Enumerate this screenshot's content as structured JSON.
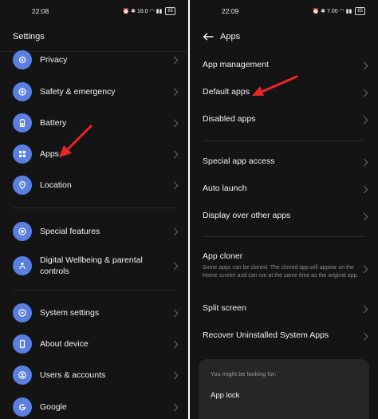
{
  "left": {
    "status_time": "22:08",
    "status_icons": "⏰ ✱ 18.0 ◠ ▮▮",
    "battery": "65",
    "title": "Settings",
    "items": [
      {
        "label": "Privacy",
        "icon": "privacy-icon"
      },
      {
        "label": "Safety & emergency",
        "icon": "safety-icon"
      },
      {
        "label": "Battery",
        "icon": "battery-icon"
      },
      {
        "label": "Apps",
        "icon": "apps-icon"
      },
      {
        "label": "Location",
        "icon": "location-icon"
      },
      {
        "label": "Special features",
        "icon": "special-features-icon"
      },
      {
        "label": "Digital Wellbeing & parental controls",
        "icon": "wellbeing-icon"
      },
      {
        "label": "System settings",
        "icon": "system-settings-icon"
      },
      {
        "label": "About device",
        "icon": "about-device-icon"
      },
      {
        "label": "Users & accounts",
        "icon": "users-icon"
      },
      {
        "label": "Google",
        "icon": "google-icon"
      }
    ]
  },
  "right": {
    "status_time": "22:09",
    "status_icons": "⏰ ✱ 7.00 ◠ ▮▮",
    "battery": "65",
    "title": "Apps",
    "items": [
      {
        "label": "App management"
      },
      {
        "label": "Default apps"
      },
      {
        "label": "Disabled apps"
      },
      {
        "label": "Special app access"
      },
      {
        "label": "Auto launch"
      },
      {
        "label": "Display over other apps"
      },
      {
        "label": "App cloner",
        "desc": "Some apps can be cloned. The cloned app will appear on the Home screen and can run at the same time as the original app."
      },
      {
        "label": "Split screen"
      },
      {
        "label": "Recover Uninstalled System Apps"
      }
    ],
    "suggest_title": "You might be looking for:",
    "suggest_item": "App lock"
  },
  "colors": {
    "accent_icon": "#5b7fe0",
    "arrow": "#e8262a",
    "bg": "#141414"
  }
}
